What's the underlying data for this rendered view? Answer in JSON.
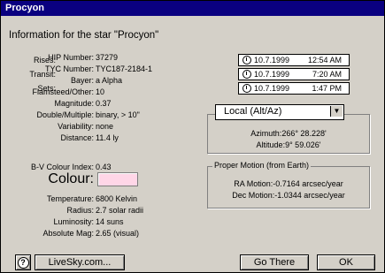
{
  "window": {
    "title": "Procyon"
  },
  "heading": "Information for  the star \"Procyon\"",
  "info": [
    {
      "label": "HIP Number:",
      "value": "37279"
    },
    {
      "label": "TYC Number:",
      "value": "TYC187-2184-1"
    },
    {
      "label": "Bayer:",
      "value": "a  Alpha"
    },
    {
      "label": "Flamsteed/Other:",
      "value": "10"
    },
    {
      "label": "Magnitude:",
      "value": "0.37"
    },
    {
      "label": "Double/Multiple:",
      "value": "binary, > 10\""
    },
    {
      "label": "Variability:",
      "value": "none"
    },
    {
      "label": "Distance:",
      "value": "11.4 ly"
    }
  ],
  "colour": {
    "bv_label": "B-V Colour Index:",
    "bv_value": "0.43",
    "colour_label": "Colour:",
    "swatch_color": "#ffd6e7"
  },
  "physical": [
    {
      "label": "Temperature:",
      "value": "6800 Kelvin"
    },
    {
      "label": "Radius:",
      "value": "2.7 solar radii"
    },
    {
      "label": "Luminosity:",
      "value": "14 suns"
    },
    {
      "label": "Absolute Mag:",
      "value": "2.65 (visual)"
    }
  ],
  "times": [
    {
      "label": "Rises:",
      "date": "10.7.1999",
      "time": "12:54 AM"
    },
    {
      "label": "Transit:",
      "date": "10.7.1999",
      "time": "7:20 AM"
    },
    {
      "label": "Sets:",
      "date": "10.7.1999",
      "time": "1:47 PM"
    }
  ],
  "coord_select": {
    "selected": "Local (Alt/Az)"
  },
  "altaz": {
    "azimuth_label": "Azimuth:",
    "azimuth_value": "266° 28.228'",
    "altitude_label": "Altitude:",
    "altitude_value": "9° 59.026'"
  },
  "proper_motion": {
    "title": "Proper Motion (from Earth)",
    "ra_label": "RA Motion:",
    "ra_value": "-0.7164 arcsec/year",
    "dec_label": "Dec Motion:",
    "dec_value": "-1.0344 arcsec/year"
  },
  "buttons": {
    "help": "?",
    "livesky": "LiveSky.com...",
    "gothere": "Go There",
    "ok": "OK"
  },
  "icons": {
    "time": "clock-icon",
    "help": "help-icon",
    "dropdown": "chevron-down-icon"
  }
}
